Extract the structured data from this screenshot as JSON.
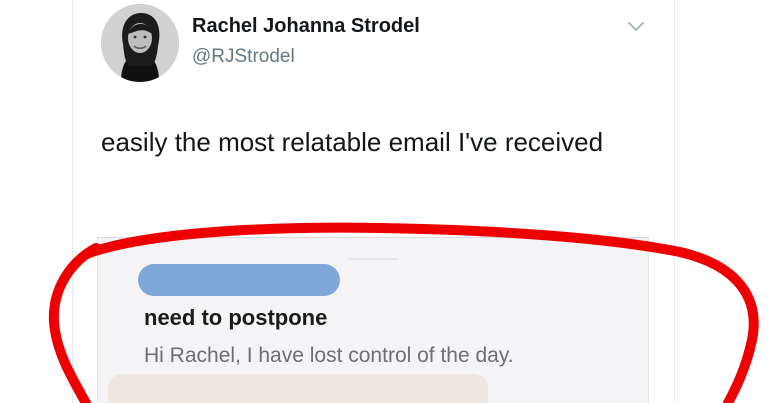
{
  "tweet": {
    "display_name": "Rachel Johanna Strodel",
    "handle": "@RJStrodel",
    "text": "easily the most relatable email I've received"
  },
  "email": {
    "sender_redacted": true,
    "subject": "need to postpone",
    "preview": "Hi Rachel, I have lost control of the day."
  },
  "icons": {
    "avatar": "profile-photo",
    "menu": "chevron-down-icon",
    "annotation": "red-hand-drawn-circle"
  },
  "colors": {
    "text_primary": "#14171a",
    "text_secondary": "#657786",
    "redaction": "#7fa6d8",
    "annotation": "#ee0000"
  }
}
